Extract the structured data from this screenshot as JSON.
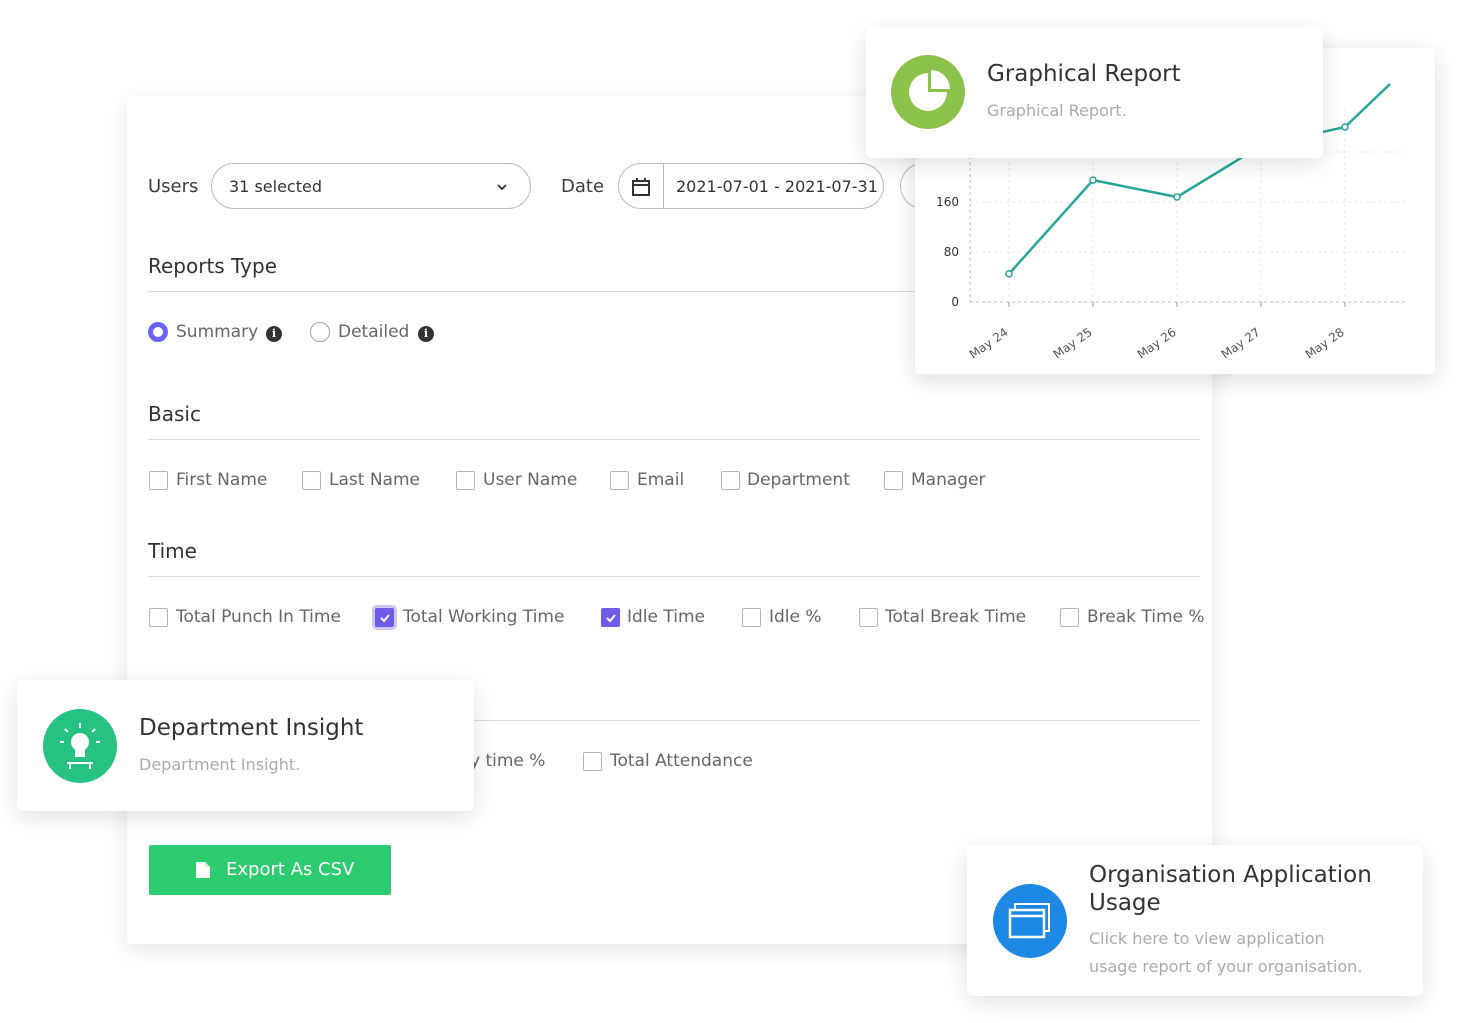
{
  "filters": {
    "users_label": "Users",
    "users_value": "31 selected",
    "date_label": "Date",
    "date_value": "2021-07-01 - 2021-07-31"
  },
  "reports_type": {
    "title": "Reports Type",
    "options": [
      {
        "label": "Summary",
        "selected": true
      },
      {
        "label": "Detailed",
        "selected": false
      }
    ]
  },
  "basic": {
    "title": "Basic",
    "fields": [
      {
        "label": "First Name",
        "checked": false
      },
      {
        "label": "Last Name",
        "checked": false
      },
      {
        "label": "User Name",
        "checked": false
      },
      {
        "label": "Email",
        "checked": false
      },
      {
        "label": "Department",
        "checked": false
      },
      {
        "label": "Manager",
        "checked": false
      }
    ]
  },
  "time": {
    "title": "Time",
    "fields": [
      {
        "label": "Total Punch In Time",
        "checked": false
      },
      {
        "label": "Total Working Time",
        "checked": true
      },
      {
        "label": "Idle Time",
        "checked": true
      },
      {
        "label": "Idle %",
        "checked": false
      },
      {
        "label": "Total Break Time",
        "checked": false
      },
      {
        "label": "Break Time %",
        "checked": false
      }
    ]
  },
  "other": {
    "fields": [
      {
        "label": "y time %"
      },
      {
        "label": "Total Attendance",
        "checked": false
      }
    ]
  },
  "export": {
    "label": "Export As CSV"
  },
  "graphical_card": {
    "title": "Graphical Report",
    "subtitle": "Graphical Report."
  },
  "department_card": {
    "title": "Department Insight",
    "subtitle": "Department Insight."
  },
  "org_card": {
    "title_line1": "Organisation Application",
    "title_line2": "Usage",
    "sub_line1": "Click here to view application",
    "sub_line2": "usage report of your organisation."
  },
  "colors": {
    "accent": "#6c5ce7",
    "green": "#2ecc71",
    "line": "#26a69a",
    "pie_green": "#8bc34a",
    "blue": "#1e88e5",
    "teal": "#26c281"
  },
  "chart_data": {
    "type": "line",
    "categories": [
      "May 24",
      "May 25",
      "May 26",
      "May 27",
      "May 28"
    ],
    "series": [
      {
        "values": [
          45,
          195,
          168,
          250,
          280
        ]
      }
    ],
    "yticks": [
      "0",
      "80",
      "160"
    ],
    "ylim": [
      0,
      340
    ],
    "grid": true
  }
}
